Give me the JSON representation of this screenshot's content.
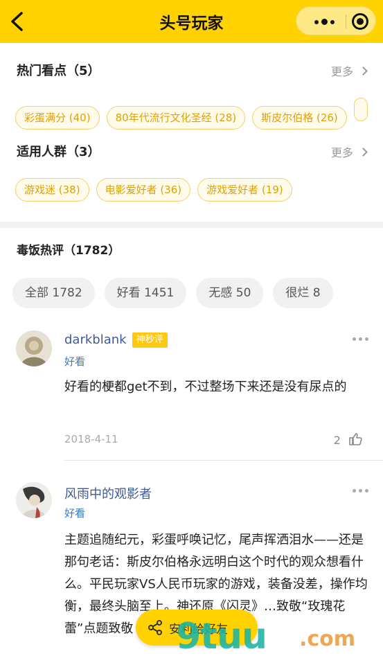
{
  "header": {
    "title": "头号玩家",
    "colors": {
      "brand": "#FFD200"
    },
    "icons": [
      "back-icon",
      "more-dots-icon",
      "target-icon"
    ]
  },
  "hot_points": {
    "title": "热门看点（5）",
    "more": "更多",
    "tags": [
      "彩蛋满分 (40)",
      "80年代流行文化圣经 (28)",
      "斯皮尔伯格 (26)"
    ]
  },
  "audience": {
    "title": "适用人群（3）",
    "more": "更多",
    "tags": [
      "游戏迷 (38)",
      "电影爱好者 (36)",
      "游戏爱好者 (19)"
    ]
  },
  "reviews": {
    "title": "毒饭热评（1782）",
    "filters": [
      "全部 1782",
      "好看 1451",
      "无感 50",
      "很烂 8"
    ],
    "items": [
      {
        "user": "darkblank",
        "badge": "神秒评",
        "rating": "好看",
        "text": "好看的梗都get不到，不过整场下来还是没有尿点的",
        "date": "2018-4-11",
        "likes": "2"
      },
      {
        "user": "风雨中的观影者",
        "rating": "好看",
        "text": "主题追随纪元，彩蛋呼唤记忆，尾声挥洒泪水——还是那句老话：斯皮尔伯格永远明白这个时代的观众想看什么。平民玩家VS人民币玩家的游戏，装备没差，操作均衡，最终头脑至上。神还原《闪灵》…致敬“玫瑰花蕾”点题致敬《公民凯恩》…"
      }
    ]
  },
  "share": {
    "label": "安利给好友"
  },
  "watermark": {
    "main": "9tuu",
    "suffix": ".com"
  }
}
